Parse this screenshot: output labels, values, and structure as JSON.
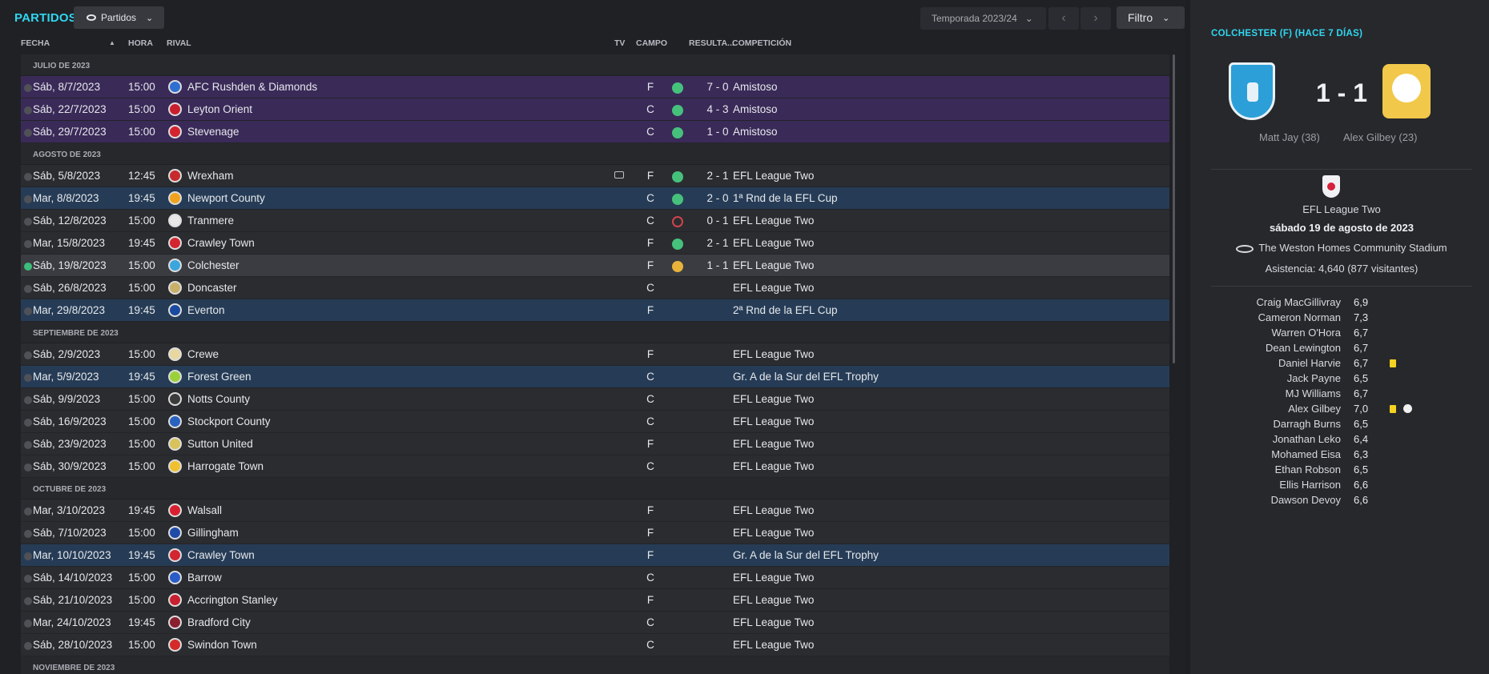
{
  "page": {
    "title": "PARTIDOS",
    "view_label": "Partidos",
    "season_label": "Temporada 2023/24",
    "filter_label": "Filtro"
  },
  "columns": {
    "date": "FECHA",
    "time": "HORA",
    "rival": "RIVAL",
    "tv": "TV",
    "field": "CAMPO",
    "result": "RESULTA...",
    "competition": "COMPETICIÓN"
  },
  "months": [
    {
      "label": "JULIO DE 2023",
      "matches": [
        {
          "date": "Sáb, 8/7/2023",
          "time": "15:00",
          "rival": "AFC Rushden & Diamonds",
          "field": "F",
          "result": "W",
          "score": "7 - 0",
          "competition": "Amistoso",
          "type": "friendly",
          "crest": "#2f6fd0"
        },
        {
          "date": "Sáb, 22/7/2023",
          "time": "15:00",
          "rival": "Leyton Orient",
          "field": "C",
          "result": "W",
          "score": "4 - 3",
          "competition": "Amistoso",
          "type": "friendly",
          "crest": "#c8202e"
        },
        {
          "date": "Sáb, 29/7/2023",
          "time": "15:00",
          "rival": "Stevenage",
          "field": "C",
          "result": "W",
          "score": "1 - 0",
          "competition": "Amistoso",
          "type": "friendly",
          "crest": "#d4232f"
        }
      ]
    },
    {
      "label": "AGOSTO DE 2023",
      "matches": [
        {
          "date": "Sáb, 5/8/2023",
          "time": "12:45",
          "rival": "Wrexham",
          "tv": true,
          "field": "F",
          "result": "W",
          "score": "2 - 1",
          "competition": "EFL League Two",
          "type": "league",
          "crest": "#c62b2e"
        },
        {
          "date": "Mar, 8/8/2023",
          "time": "19:45",
          "rival": "Newport County",
          "field": "C",
          "result": "W",
          "score": "2 - 0",
          "competition": "1ª Rnd de la EFL Cup",
          "type": "cup",
          "crest": "#f0a21f"
        },
        {
          "date": "Sáb, 12/8/2023",
          "time": "15:00",
          "rival": "Tranmere",
          "field": "C",
          "result": "L",
          "score": "0 - 1",
          "competition": "EFL League Two",
          "type": "league",
          "crest": "#e8e8e8"
        },
        {
          "date": "Mar, 15/8/2023",
          "time": "19:45",
          "rival": "Crawley Town",
          "field": "F",
          "result": "W",
          "score": "2 - 1",
          "competition": "EFL League Two",
          "type": "league",
          "crest": "#d3252f"
        },
        {
          "date": "Sáb, 19/8/2023",
          "time": "15:00",
          "rival": "Colchester",
          "field": "F",
          "result": "D",
          "score": "1 - 1",
          "competition": "EFL League Two",
          "type": "current",
          "crest": "#3ba6de"
        },
        {
          "date": "Sáb, 26/8/2023",
          "time": "15:00",
          "rival": "Doncaster",
          "field": "C",
          "result": "",
          "score": "",
          "competition": "EFL League Two",
          "type": "league",
          "crest": "#c9b06a"
        },
        {
          "date": "Mar, 29/8/2023",
          "time": "19:45",
          "rival": "Everton",
          "field": "F",
          "result": "",
          "score": "",
          "competition": "2ª Rnd de la EFL Cup",
          "type": "cup",
          "crest": "#1a4aa0"
        }
      ]
    },
    {
      "label": "SEPTIEMBRE DE 2023",
      "matches": [
        {
          "date": "Sáb, 2/9/2023",
          "time": "15:00",
          "rival": "Crewe",
          "field": "F",
          "result": "",
          "score": "",
          "competition": "EFL League Two",
          "type": "league",
          "crest": "#e8d8a0"
        },
        {
          "date": "Mar, 5/9/2023",
          "time": "19:45",
          "rival": "Forest Green",
          "field": "C",
          "result": "",
          "score": "",
          "competition": "Gr. A de la Sur del EFL Trophy",
          "type": "cup",
          "crest": "#9ad13a"
        },
        {
          "date": "Sáb, 9/9/2023",
          "time": "15:00",
          "rival": "Notts County",
          "field": "C",
          "result": "",
          "score": "",
          "competition": "EFL League Two",
          "type": "league",
          "crest": "#3b3b3b"
        },
        {
          "date": "Sáb, 16/9/2023",
          "time": "15:00",
          "rival": "Stockport County",
          "field": "C",
          "result": "",
          "score": "",
          "competition": "EFL League Two",
          "type": "league",
          "crest": "#2a62c0"
        },
        {
          "date": "Sáb, 23/9/2023",
          "time": "15:00",
          "rival": "Sutton United",
          "field": "F",
          "result": "",
          "score": "",
          "competition": "EFL League Two",
          "type": "league",
          "crest": "#d8c25a"
        },
        {
          "date": "Sáb, 30/9/2023",
          "time": "15:00",
          "rival": "Harrogate Town",
          "field": "C",
          "result": "",
          "score": "",
          "competition": "EFL League Two",
          "type": "league",
          "crest": "#f0c030"
        }
      ]
    },
    {
      "label": "OCTUBRE DE 2023",
      "matches": [
        {
          "date": "Mar, 3/10/2023",
          "time": "19:45",
          "rival": "Walsall",
          "field": "F",
          "result": "",
          "score": "",
          "competition": "EFL League Two",
          "type": "league",
          "crest": "#d82030"
        },
        {
          "date": "Sáb, 7/10/2023",
          "time": "15:00",
          "rival": "Gillingham",
          "field": "F",
          "result": "",
          "score": "",
          "competition": "EFL League Two",
          "type": "league",
          "crest": "#1f4aa8"
        },
        {
          "date": "Mar, 10/10/2023",
          "time": "19:45",
          "rival": "Crawley Town",
          "field": "F",
          "result": "",
          "score": "",
          "competition": "Gr. A de la Sur del EFL Trophy",
          "type": "cup",
          "crest": "#d3252f"
        },
        {
          "date": "Sáb, 14/10/2023",
          "time": "15:00",
          "rival": "Barrow",
          "field": "C",
          "result": "",
          "score": "",
          "competition": "EFL League Two",
          "type": "league",
          "crest": "#2a5cc8"
        },
        {
          "date": "Sáb, 21/10/2023",
          "time": "15:00",
          "rival": "Accrington Stanley",
          "field": "F",
          "result": "",
          "score": "",
          "competition": "EFL League Two",
          "type": "league",
          "crest": "#c82030"
        },
        {
          "date": "Mar, 24/10/2023",
          "time": "19:45",
          "rival": "Bradford City",
          "field": "C",
          "result": "",
          "score": "",
          "competition": "EFL League Two",
          "type": "league",
          "crest": "#8a1f2f"
        },
        {
          "date": "Sáb, 28/10/2023",
          "time": "15:00",
          "rival": "Swindon Town",
          "field": "C",
          "result": "",
          "score": "",
          "competition": "EFL League Two",
          "type": "league",
          "crest": "#d42a2a"
        }
      ]
    },
    {
      "label": "NOVIEMBRE DE 2023",
      "matches": []
    }
  ],
  "detail": {
    "title": "COLCHESTER (F) (HACE 7 DÍAS)",
    "score": "1 - 1",
    "home_scorer": "Matt Jay (38)",
    "away_scorer": "Alex Gilbey (23)",
    "competition": "EFL League Two",
    "date": "sábado 19 de agosto de 2023",
    "stadium": "The Weston Homes Community Stadium",
    "attendance": "Asistencia: 4,640 (877 visitantes)",
    "ratings": [
      {
        "name": "Craig MacGillivray",
        "value": "6,9"
      },
      {
        "name": "Cameron Norman",
        "value": "7,3"
      },
      {
        "name": "Warren O'Hora",
        "value": "6,7"
      },
      {
        "name": "Dean Lewington",
        "value": "6,7"
      },
      {
        "name": "Daniel Harvie",
        "value": "6,7",
        "card": true
      },
      {
        "name": "Jack Payne",
        "value": "6,5"
      },
      {
        "name": "MJ Williams",
        "value": "6,7"
      },
      {
        "name": "Alex Gilbey",
        "value": "7,0",
        "card": true,
        "goal": true
      },
      {
        "name": "Darragh Burns",
        "value": "6,5"
      },
      {
        "name": "Jonathan Leko",
        "value": "6,4"
      },
      {
        "name": "Mohamed Eisa",
        "value": "6,3"
      },
      {
        "name": "Ethan Robson",
        "value": "6,5"
      },
      {
        "name": "Ellis Harrison",
        "value": "6,6"
      },
      {
        "name": "Dawson Devoy",
        "value": "6,6"
      }
    ]
  }
}
